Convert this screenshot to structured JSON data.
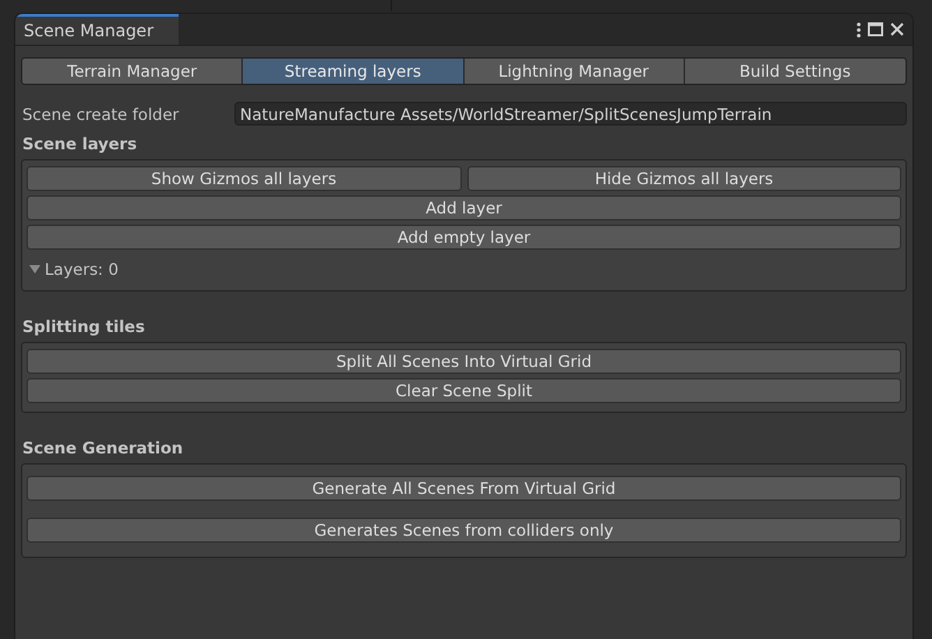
{
  "window": {
    "title": "Scene Manager"
  },
  "tabs": [
    {
      "label": "Terrain Manager",
      "selected": false
    },
    {
      "label": "Streaming layers",
      "selected": true
    },
    {
      "label": "Lightning Manager",
      "selected": false
    },
    {
      "label": "Build Settings",
      "selected": false
    }
  ],
  "scene_create_folder": {
    "label": "Scene create folder",
    "value": "NatureManufacture Assets/WorldStreamer/SplitScenesJumpTerrain"
  },
  "sections": [
    {
      "title": "Scene layers",
      "rows": [
        [
          "Show Gizmos all layers",
          "Hide Gizmos all layers"
        ],
        [
          "Add layer"
        ],
        [
          "Add empty layer"
        ]
      ],
      "foldout": {
        "label": "Layers: 0",
        "expanded": true
      }
    },
    {
      "title": "Splitting tiles",
      "rows": [
        [
          "Split All Scenes Into Virtual Grid"
        ],
        [
          "Clear Scene Split"
        ]
      ]
    },
    {
      "title": "Scene Generation",
      "rows": [
        [
          "Generate All Scenes From Virtual Grid"
        ],
        [
          "Generates Scenes from colliders only"
        ]
      ],
      "spaced": true
    }
  ]
}
